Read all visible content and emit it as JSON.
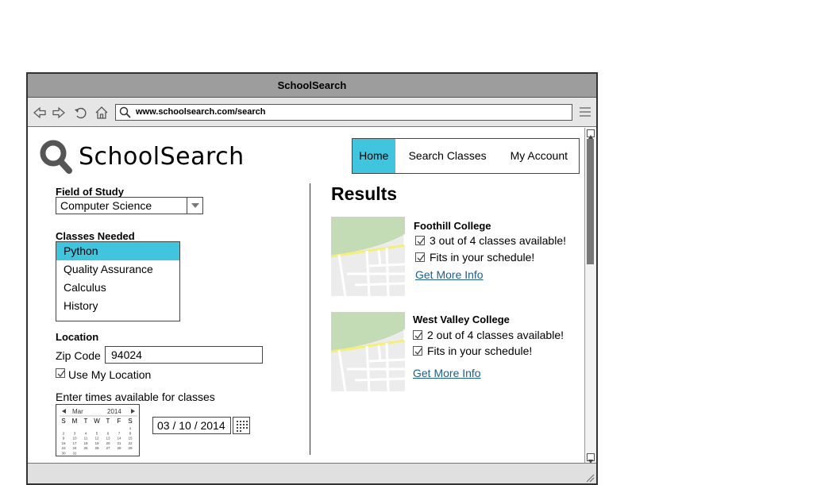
{
  "window": {
    "title": "SchoolSearch"
  },
  "browser": {
    "url": "www.schoolsearch.com/search",
    "icons": [
      "back-arrow-icon",
      "forward-arrow-icon",
      "reload-icon",
      "home-icon",
      "search-icon",
      "hamburger-menu-icon"
    ]
  },
  "site": {
    "logo_text": "SchoolSearch",
    "nav": [
      "Home",
      "Search Classes",
      "My Account"
    ],
    "active_nav": "Home",
    "accent_color": "#41c4de"
  },
  "filters": {
    "field_label": "Field of Study",
    "field_value": "Computer Science",
    "classes_label": "Classes Needed",
    "classes": [
      "Python",
      "Quality Assurance",
      "Calculus",
      "History"
    ],
    "selected_class": "Python",
    "location_label": "Location",
    "zip_label": "Zip Code",
    "zip_value": "94024",
    "use_location_label": "Use My Location",
    "use_location_checked": true,
    "times_label": "Enter times available for classes",
    "calendar": {
      "month": "Mar",
      "year": "2014",
      "weekdays": [
        "S",
        "M",
        "T",
        "W",
        "T",
        "F",
        "S"
      ],
      "weeks": [
        [
          "",
          "",
          "",
          "",
          "",
          "",
          "1"
        ],
        [
          "2",
          "3",
          "4",
          "5",
          "6",
          "7",
          "8"
        ],
        [
          "9",
          "10",
          "11",
          "12",
          "13",
          "14",
          "15"
        ],
        [
          "16",
          "17",
          "18",
          "19",
          "20",
          "21",
          "22"
        ],
        [
          "23",
          "24",
          "25",
          "26",
          "27",
          "28",
          "29"
        ],
        [
          "30",
          "31",
          "",
          "",
          "",
          "",
          ""
        ]
      ]
    },
    "date_value": "03 / 10 / 2014"
  },
  "results": {
    "title": "Results",
    "items": [
      {
        "name": "Foothill College",
        "availability": "3 out of 4 classes available!",
        "schedule": "Fits in your schedule!",
        "link": "Get More Info"
      },
      {
        "name": "West Valley College",
        "availability": "2 out of 4 classes available!",
        "schedule": "Fits in your schedule!",
        "link": "Get More Info"
      }
    ]
  }
}
